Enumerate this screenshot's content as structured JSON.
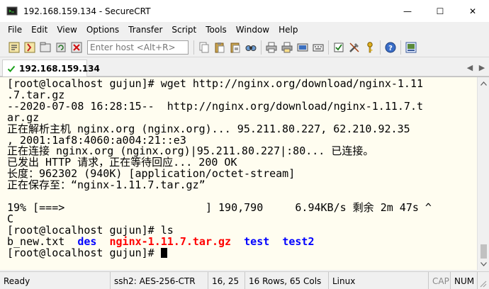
{
  "window": {
    "title": "192.168.159.134 - SecureCRT",
    "minimize": "—",
    "maximize": "☐",
    "close": "✕"
  },
  "menu": [
    "File",
    "Edit",
    "View",
    "Options",
    "Transfer",
    "Script",
    "Tools",
    "Window",
    "Help"
  ],
  "toolbar": {
    "host_placeholder": "Enter host <Alt+R>"
  },
  "tab": {
    "label": "192.168.159.134",
    "prev_arrow": "◀",
    "next_arrow": "▶"
  },
  "terminal": {
    "lines": [
      "[root@localhost gujun]# wget http://nginx.org/download/nginx-1.11",
      ".7.tar.gz",
      "--2020-07-08 16:28:15--  http://nginx.org/download/nginx-1.11.7.t",
      "ar.gz",
      "正在解析主机 nginx.org (nginx.org)... 95.211.80.227, 62.210.92.35",
      ", 2001:1af8:4060:a004:21::e3",
      "正在连接 nginx.org (nginx.org)|95.211.80.227|:80... 已连接。",
      "已发出 HTTP 请求，正在等待回应... 200 OK",
      "长度：962302 (940K) [application/octet-stream]",
      "正在保存至：“nginx-1.11.7.tar.gz”",
      "",
      "19% [===>                      ] 190,790     6.94KB/s 剩余 2m 47s ^",
      "C",
      "[root@localhost gujun]# ls"
    ],
    "ls_output": {
      "file": "b_new.txt",
      "dir1": "des",
      "archive": "nginx-1.11.7.tar.gz",
      "dir2": "test",
      "dir3": "test2"
    },
    "prompt": "[root@localhost gujun]# "
  },
  "status": {
    "ready": "Ready",
    "cipher": "ssh2: AES-256-CTR",
    "position": "16, 25",
    "size": "16 Rows, 65 Cols",
    "term": "Linux",
    "cap": "CAP",
    "num": "NUM"
  }
}
